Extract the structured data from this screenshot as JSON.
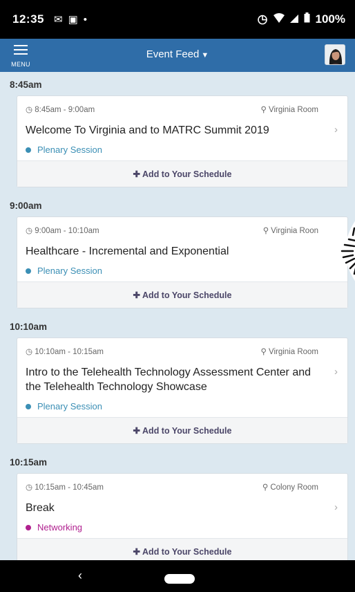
{
  "status_bar": {
    "time": "12:35",
    "battery": "100%",
    "icons": [
      "gmail-icon",
      "gallery-icon",
      "dot-icon",
      "alarm-icon",
      "wifi-icon",
      "signal-icon",
      "battery-icon"
    ]
  },
  "app_bar": {
    "menu_label": "MENU",
    "title": "Event Feed",
    "color": "#2f6da8"
  },
  "feed": {
    "groups": [
      {
        "time": "8:45am",
        "event": {
          "time_range": "8:45am - 9:00am",
          "location": "Virginia Room",
          "title": "Welcome To Virginia and to MATRC Summit 2019",
          "track": "Plenary Session",
          "track_color": "#3b8fb5",
          "add_label": "Add to Your Schedule"
        }
      },
      {
        "time": "9:00am",
        "event": {
          "time_range": "9:00am - 10:10am",
          "location": "Virginia Roon",
          "title": "Healthcare - Incremental and Exponential",
          "track": "Plenary Session",
          "track_color": "#3b8fb5",
          "add_label": "Add to Your Schedule"
        }
      },
      {
        "time": "10:10am",
        "event": {
          "time_range": "10:10am - 10:15am",
          "location": "Virginia Room",
          "title": "Intro to the Telehealth Technology Assessment Center and the Telehealth Technology Showcase",
          "track": "Plenary Session",
          "track_color": "#3b8fb5",
          "add_label": "Add to Your Schedule"
        }
      },
      {
        "time": "10:15am",
        "event": {
          "time_range": "10:15am - 10:45am",
          "location": "Colony Room",
          "title": "Break",
          "track": "Networking",
          "track_color": "#b0208f",
          "add_label": "Add to Your Schedule"
        }
      }
    ]
  },
  "nav_bar": {
    "back_icon": "back-icon",
    "home_icon": "home-pill-icon"
  }
}
